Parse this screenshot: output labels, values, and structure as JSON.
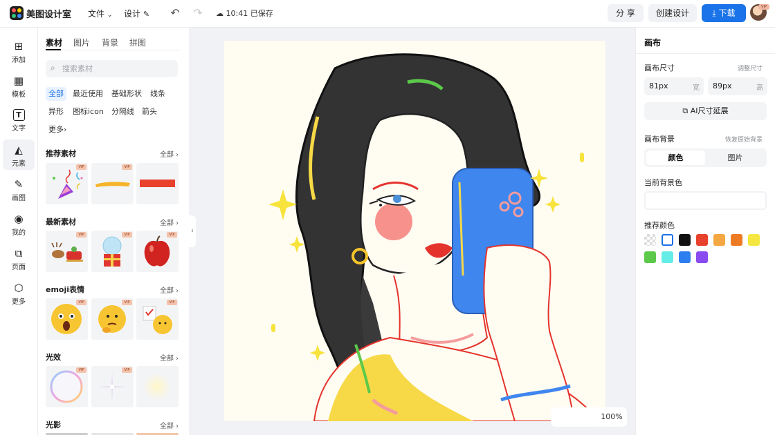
{
  "app": {
    "name": "美图设计室"
  },
  "topbar": {
    "file_label": "文件",
    "design_label": "设计",
    "saved_status": "10:41 已保存",
    "share_label": "分 享",
    "create_label": "创建设计",
    "download_label": "下载",
    "avatar_badge": "VIP"
  },
  "rail": [
    {
      "label": "添加",
      "icon": "plus-square-icon"
    },
    {
      "label": "模板",
      "icon": "template-icon"
    },
    {
      "label": "文字",
      "icon": "text-icon"
    },
    {
      "label": "元素",
      "icon": "elements-icon"
    },
    {
      "label": "画图",
      "icon": "draw-icon"
    },
    {
      "label": "我的",
      "icon": "user-icon"
    },
    {
      "label": "页面",
      "icon": "page-icon"
    },
    {
      "label": "更多",
      "icon": "cube-icon"
    }
  ],
  "panel": {
    "tabs": [
      "素材",
      "图片",
      "背景",
      "拼图"
    ],
    "search_placeholder": "搜索素材",
    "chips": [
      "全部",
      "最近使用",
      "基础形状",
      "线条",
      "异形",
      "图标icon",
      "分隔线",
      "箭头",
      "更多"
    ],
    "all_label": "全部",
    "vip_label": "VIP",
    "sections": [
      "推荐素材",
      "最新素材",
      "emoji表情",
      "光效",
      "光影"
    ]
  },
  "canvas": {
    "zoom_value": "100%"
  },
  "right_panel": {
    "title": "画布",
    "size_label": "画布尺寸",
    "adjust_size_label": "调整尺寸",
    "width_value": "81px",
    "width_unit": "宽",
    "height_value": "89px",
    "height_unit": "高",
    "ai_extend_label": "AI尺寸延展",
    "bg_label": "画布背景",
    "restore_bg_label": "恢复原始背景",
    "seg_color": "颜色",
    "seg_image": "图片",
    "current_bg_label": "当前背景色",
    "recommended_label": "推荐颜色",
    "swatches": [
      "transparent",
      "#ffffff",
      "#111111",
      "#e8412c",
      "#f5a741",
      "#ee7a23",
      "#f5e742",
      "#5cc94a",
      "#64ece6",
      "#2d7ff0",
      "#8a4bf0"
    ]
  },
  "colors": {
    "accent": "#1a73e8",
    "topbar_bg": "#ffffff",
    "workspace_bg": "#f1f2f5"
  }
}
